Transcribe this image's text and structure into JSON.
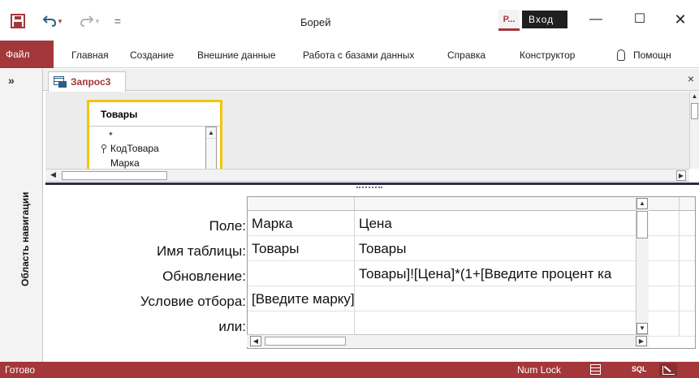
{
  "app": {
    "title": "Борей",
    "account_badge": "Р...",
    "signin_label": "Вход",
    "minimize_glyph": "—",
    "maximize_glyph": "☐",
    "close_glyph": "✕"
  },
  "qat": {
    "save_icon": "save-icon",
    "undo_icon": "undo-icon",
    "redo_icon": "redo-icon"
  },
  "ribbon": {
    "tabs": [
      "Файл",
      "Главная",
      "Создание",
      "Внешние данные",
      "Работа с базами данных",
      "Справка",
      "Конструктор"
    ],
    "help_label": "Помощн"
  },
  "navpane": {
    "toggle_glyph": "»",
    "label": "Область навигации"
  },
  "document": {
    "tab_label": "Запрос3",
    "close_glyph": "×"
  },
  "table": {
    "name": "Товары",
    "fields": [
      "*",
      "КодТовара",
      "Марка"
    ]
  },
  "grid": {
    "row_labels": [
      "Поле:",
      "Имя таблицы:",
      "Обновление:",
      "Условие отбора:",
      "или:"
    ],
    "columns": [
      {
        "field": "Марка",
        "table": "Товары",
        "update": "",
        "criteria": "[Введите марку]",
        "or": ""
      },
      {
        "field": "Цена",
        "table": "Товары",
        "update": "Товары]![Цена]*(1+[Введите процент ка",
        "criteria": "",
        "or": ""
      }
    ]
  },
  "status": {
    "ready": "Готово",
    "num_lock": "Num Lock",
    "sql_label": "SQL"
  },
  "colors": {
    "accent": "#a4373a",
    "table_border": "#f2c600"
  }
}
